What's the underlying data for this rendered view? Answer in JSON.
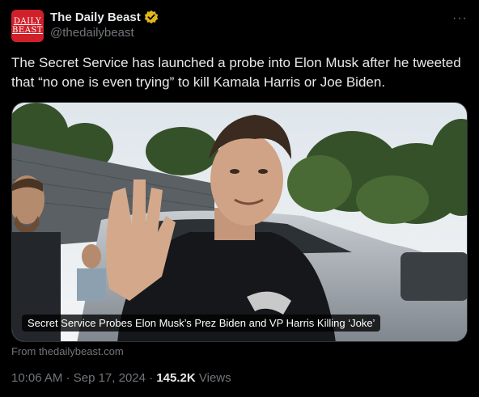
{
  "account": {
    "avatar_text_line1": "DAILY",
    "avatar_text_line2": "BEAST",
    "display_name": "The Daily Beast",
    "handle": "@thedailybeast",
    "more_label": "···"
  },
  "tweet": {
    "text": "The Secret Service has launched a probe into Elon Musk after he tweeted that “no one is even trying” to kill Kamala Harris or Joe Biden."
  },
  "card": {
    "caption": "Secret Service Probes Elon Musk’s Prez Biden and VP Harris Killing ‘Joke’",
    "source": "From thedailybeast.com"
  },
  "meta": {
    "time": "10:06 AM",
    "separator": "·",
    "date": "Sep 17, 2024",
    "views_count": "145.2K",
    "views_label": "Views"
  },
  "colors": {
    "brand_red": "#d0202a",
    "verified_gold": "#e2b719",
    "muted_text": "#71767b"
  },
  "icons": [
    "verified-badge-icon",
    "more-options-icon"
  ]
}
